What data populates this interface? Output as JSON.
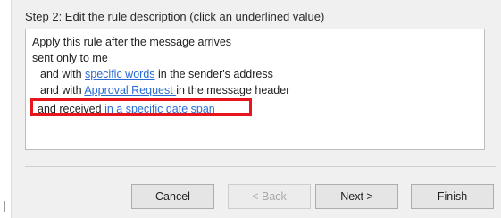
{
  "step": {
    "label": "Step 2: Edit the rule description (click an underlined value)"
  },
  "description": {
    "lines": [
      {
        "text": "Apply this rule after the message arrives"
      },
      {
        "text": "sent only to me"
      },
      {
        "prefix": "and with ",
        "link": "specific words",
        "suffix": " in the sender's address"
      },
      {
        "prefix": "and with ",
        "link": "Approval Request ",
        "suffix": " in the message header"
      },
      {
        "prefix": "and received ",
        "link": "in a specific date span",
        "suffix": ""
      }
    ],
    "highlight_color": "#e8141e",
    "link_color": "#2a6bd4"
  },
  "buttons": {
    "cancel": "Cancel",
    "back": "< Back",
    "next": "Next >",
    "finish": "Finish"
  }
}
